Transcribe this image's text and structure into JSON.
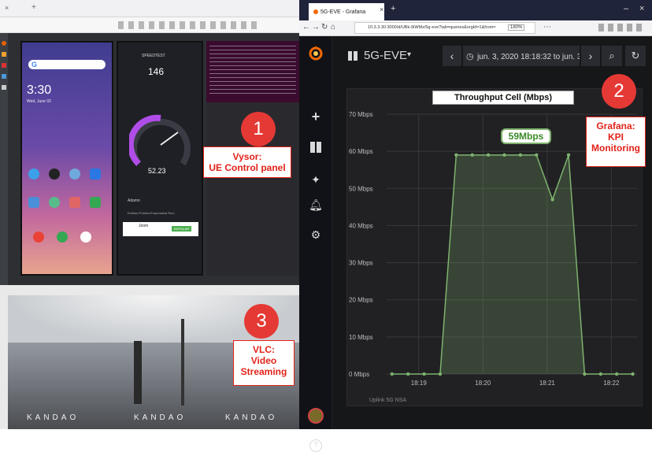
{
  "left_window": {
    "tab_close_glyph": "×",
    "tab_new_glyph": "+"
  },
  "browser": {
    "tab_title": "5G-EVE - Grafana",
    "tab_close": "×",
    "tab_new": "+",
    "url": "10.3.3.30:3000/d/UBk-9iWMz/5g-eve?tab=queries&orgId=1&from=",
    "zoom": "180%",
    "window_min": "–",
    "window_close": "×"
  },
  "grafana": {
    "dashboard_title": "5G-EVE",
    "time_range": "jun. 3, 2020 18:18:32 to jun. 3",
    "panel_title": "Throughput Cell (Mbps)",
    "legend_partial": "Uplink 5G NSA"
  },
  "phone1": {
    "clock": "3:30",
    "date": "Wed, June 03"
  },
  "phone2": {
    "app_name": "SPEEDTEST",
    "ping_value": "146",
    "speed_value": "52.23",
    "unit": "Mbps",
    "provider_name": "Adamo",
    "provider_sub": "Entidad Publica Empresarial Red...",
    "ad_name": "Joom",
    "ad_button": "INSTALAR"
  },
  "callouts": {
    "n1": "1",
    "n2": "2",
    "n3": "3",
    "label1_line1": "Vysor:",
    "label1_line2": "UE Control panel",
    "label2_line1": "Grafana:",
    "label2_line2": "KPI",
    "label2_line3": "Monitoring",
    "label3_line1": "VLC:",
    "label3_line2": "Video",
    "label3_line3": "Streaming",
    "peak_label": "59Mbps"
  },
  "vlc": {
    "watermark": "KANDAO"
  },
  "chart_data": {
    "type": "area",
    "title": "Throughput Cell (Mbps)",
    "y_ticks": [
      "0 Mbps",
      "10 Mbps",
      "20 Mbps",
      "30 Mbps",
      "40 Mbps",
      "50 Mbps",
      "60 Mbps",
      "70 Mbps"
    ],
    "x_ticks": [
      "18:19",
      "18:20",
      "18:21",
      "18:22"
    ],
    "ylim": [
      0,
      70
    ],
    "x": [
      "18:18:35",
      "18:18:50",
      "18:19:05",
      "18:19:20",
      "18:19:35",
      "18:19:50",
      "18:20:05",
      "18:20:20",
      "18:20:35",
      "18:20:50",
      "18:21:05",
      "18:21:20",
      "18:21:35",
      "18:21:50",
      "18:22:05",
      "18:22:20"
    ],
    "series": [
      {
        "name": "",
        "color": "#7eb26d",
        "values": [
          0,
          0,
          0,
          0,
          59,
          59,
          59,
          59,
          59,
          59,
          47,
          59,
          0,
          0,
          0,
          0
        ]
      }
    ]
  },
  "colors": {
    "accent": "#7eb26d",
    "badge": "#e53935",
    "note_text": "#e2231a",
    "grafana_bg": "#161719"
  }
}
